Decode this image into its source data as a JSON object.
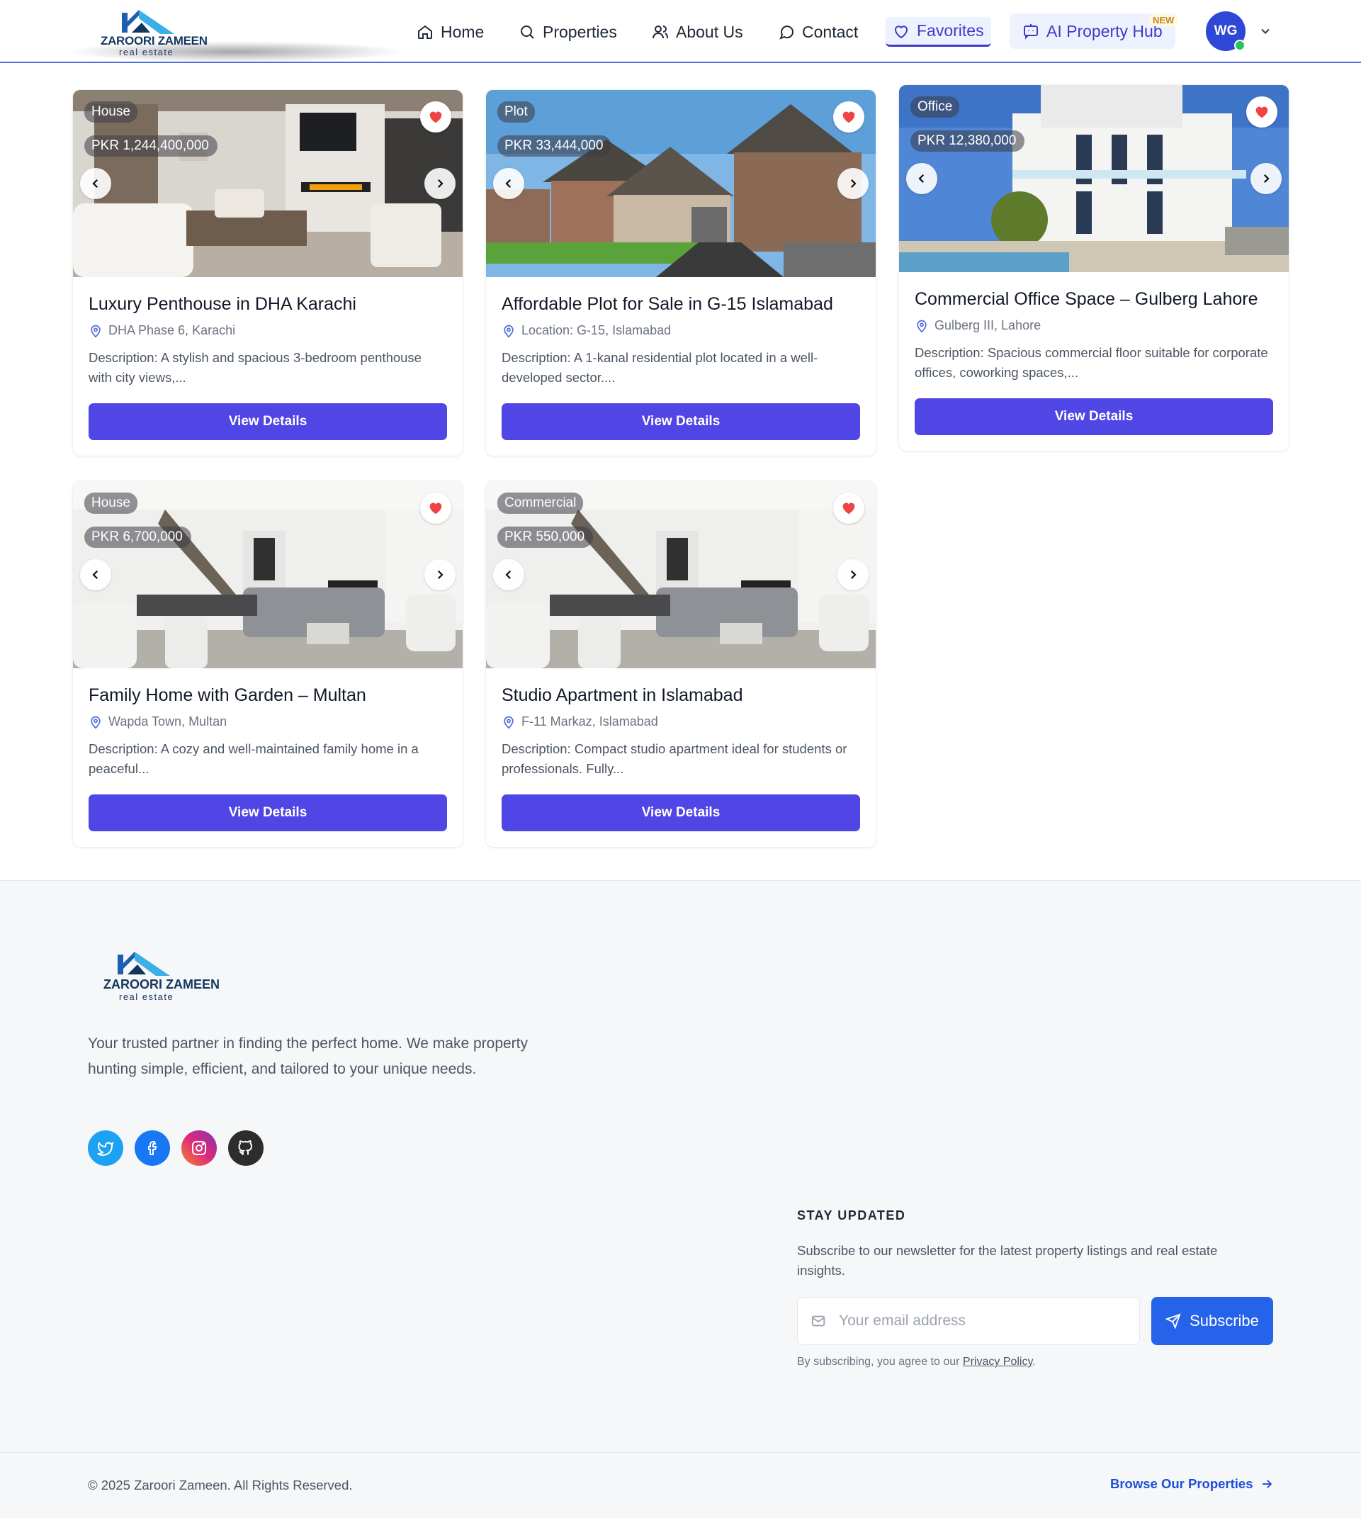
{
  "brand": {
    "name": "ZAROORI ZAMEEN",
    "tagline": "real estate"
  },
  "nav": {
    "home": "Home",
    "properties": "Properties",
    "about": "About Us",
    "contact": "Contact",
    "favorites": "Favorites",
    "ai_hub": "AI Property Hub",
    "ai_badge": "NEW",
    "user_initials": "WG"
  },
  "cards": [
    {
      "type": "House",
      "price": "PKR 1,244,400,000",
      "title": "Luxury Penthouse in DHA Karachi",
      "location": "DHA Phase 6, Karachi",
      "description": "Description: A stylish and spacious 3-bedroom penthouse with city views,...",
      "button": "View Details",
      "image": "living-room"
    },
    {
      "type": "Plot",
      "price": "PKR 33,444,000",
      "title": "Affordable Plot for Sale in G-15 Islamabad",
      "location": "Location: G-15, Islamabad",
      "description": "Description: A 1-kanal residential plot located in a well-developed sector....",
      "button": "View Details",
      "image": "houses-exterior"
    },
    {
      "type": "Office",
      "price": "PKR 12,380,000",
      "title": "Commercial Office Space – Gulberg Lahore",
      "location": "Gulberg III, Lahore",
      "description": "Description: Spacious commercial floor suitable for corporate offices, coworking spaces,...",
      "button": "View Details",
      "image": "white-villa"
    },
    {
      "type": "House",
      "price": "PKR 6,700,000",
      "title": "Family Home with Garden – Multan",
      "location": "Wapda Town, Multan",
      "description": "Description: A cozy and well-maintained family home in a peaceful...",
      "button": "View Details",
      "image": "dining-living"
    },
    {
      "type": "Commercial",
      "price": "PKR 550,000",
      "title": "Studio Apartment in Islamabad",
      "location": "F-11 Markaz, Islamabad",
      "description": "Description: Compact studio apartment ideal for students or professionals. Fully...",
      "button": "View Details",
      "image": "dining-living"
    }
  ],
  "footer": {
    "about": "Your trusted partner in finding the perfect home. We make property hunting simple, efficient, and tailored to your unique needs.",
    "social": [
      "twitter-icon",
      "facebook-icon",
      "instagram-icon",
      "github-icon"
    ],
    "newsletter_title": "STAY UPDATED",
    "newsletter_text": "Subscribe to our newsletter for the latest property listings and real estate insights.",
    "email_placeholder": "Your email address",
    "subscribe_label": "Subscribe",
    "consent_prefix": "By subscribing, you agree to our ",
    "consent_link": "Privacy Policy",
    "consent_suffix": ".",
    "copyright": "© 2025 Zaroori Zameen. All Rights Reserved.",
    "browse_link": "Browse Our Properties"
  },
  "colors": {
    "primary": "#4f46e5",
    "accent": "#2563eb",
    "heart": "#ef4444",
    "brand": "#13365f"
  }
}
